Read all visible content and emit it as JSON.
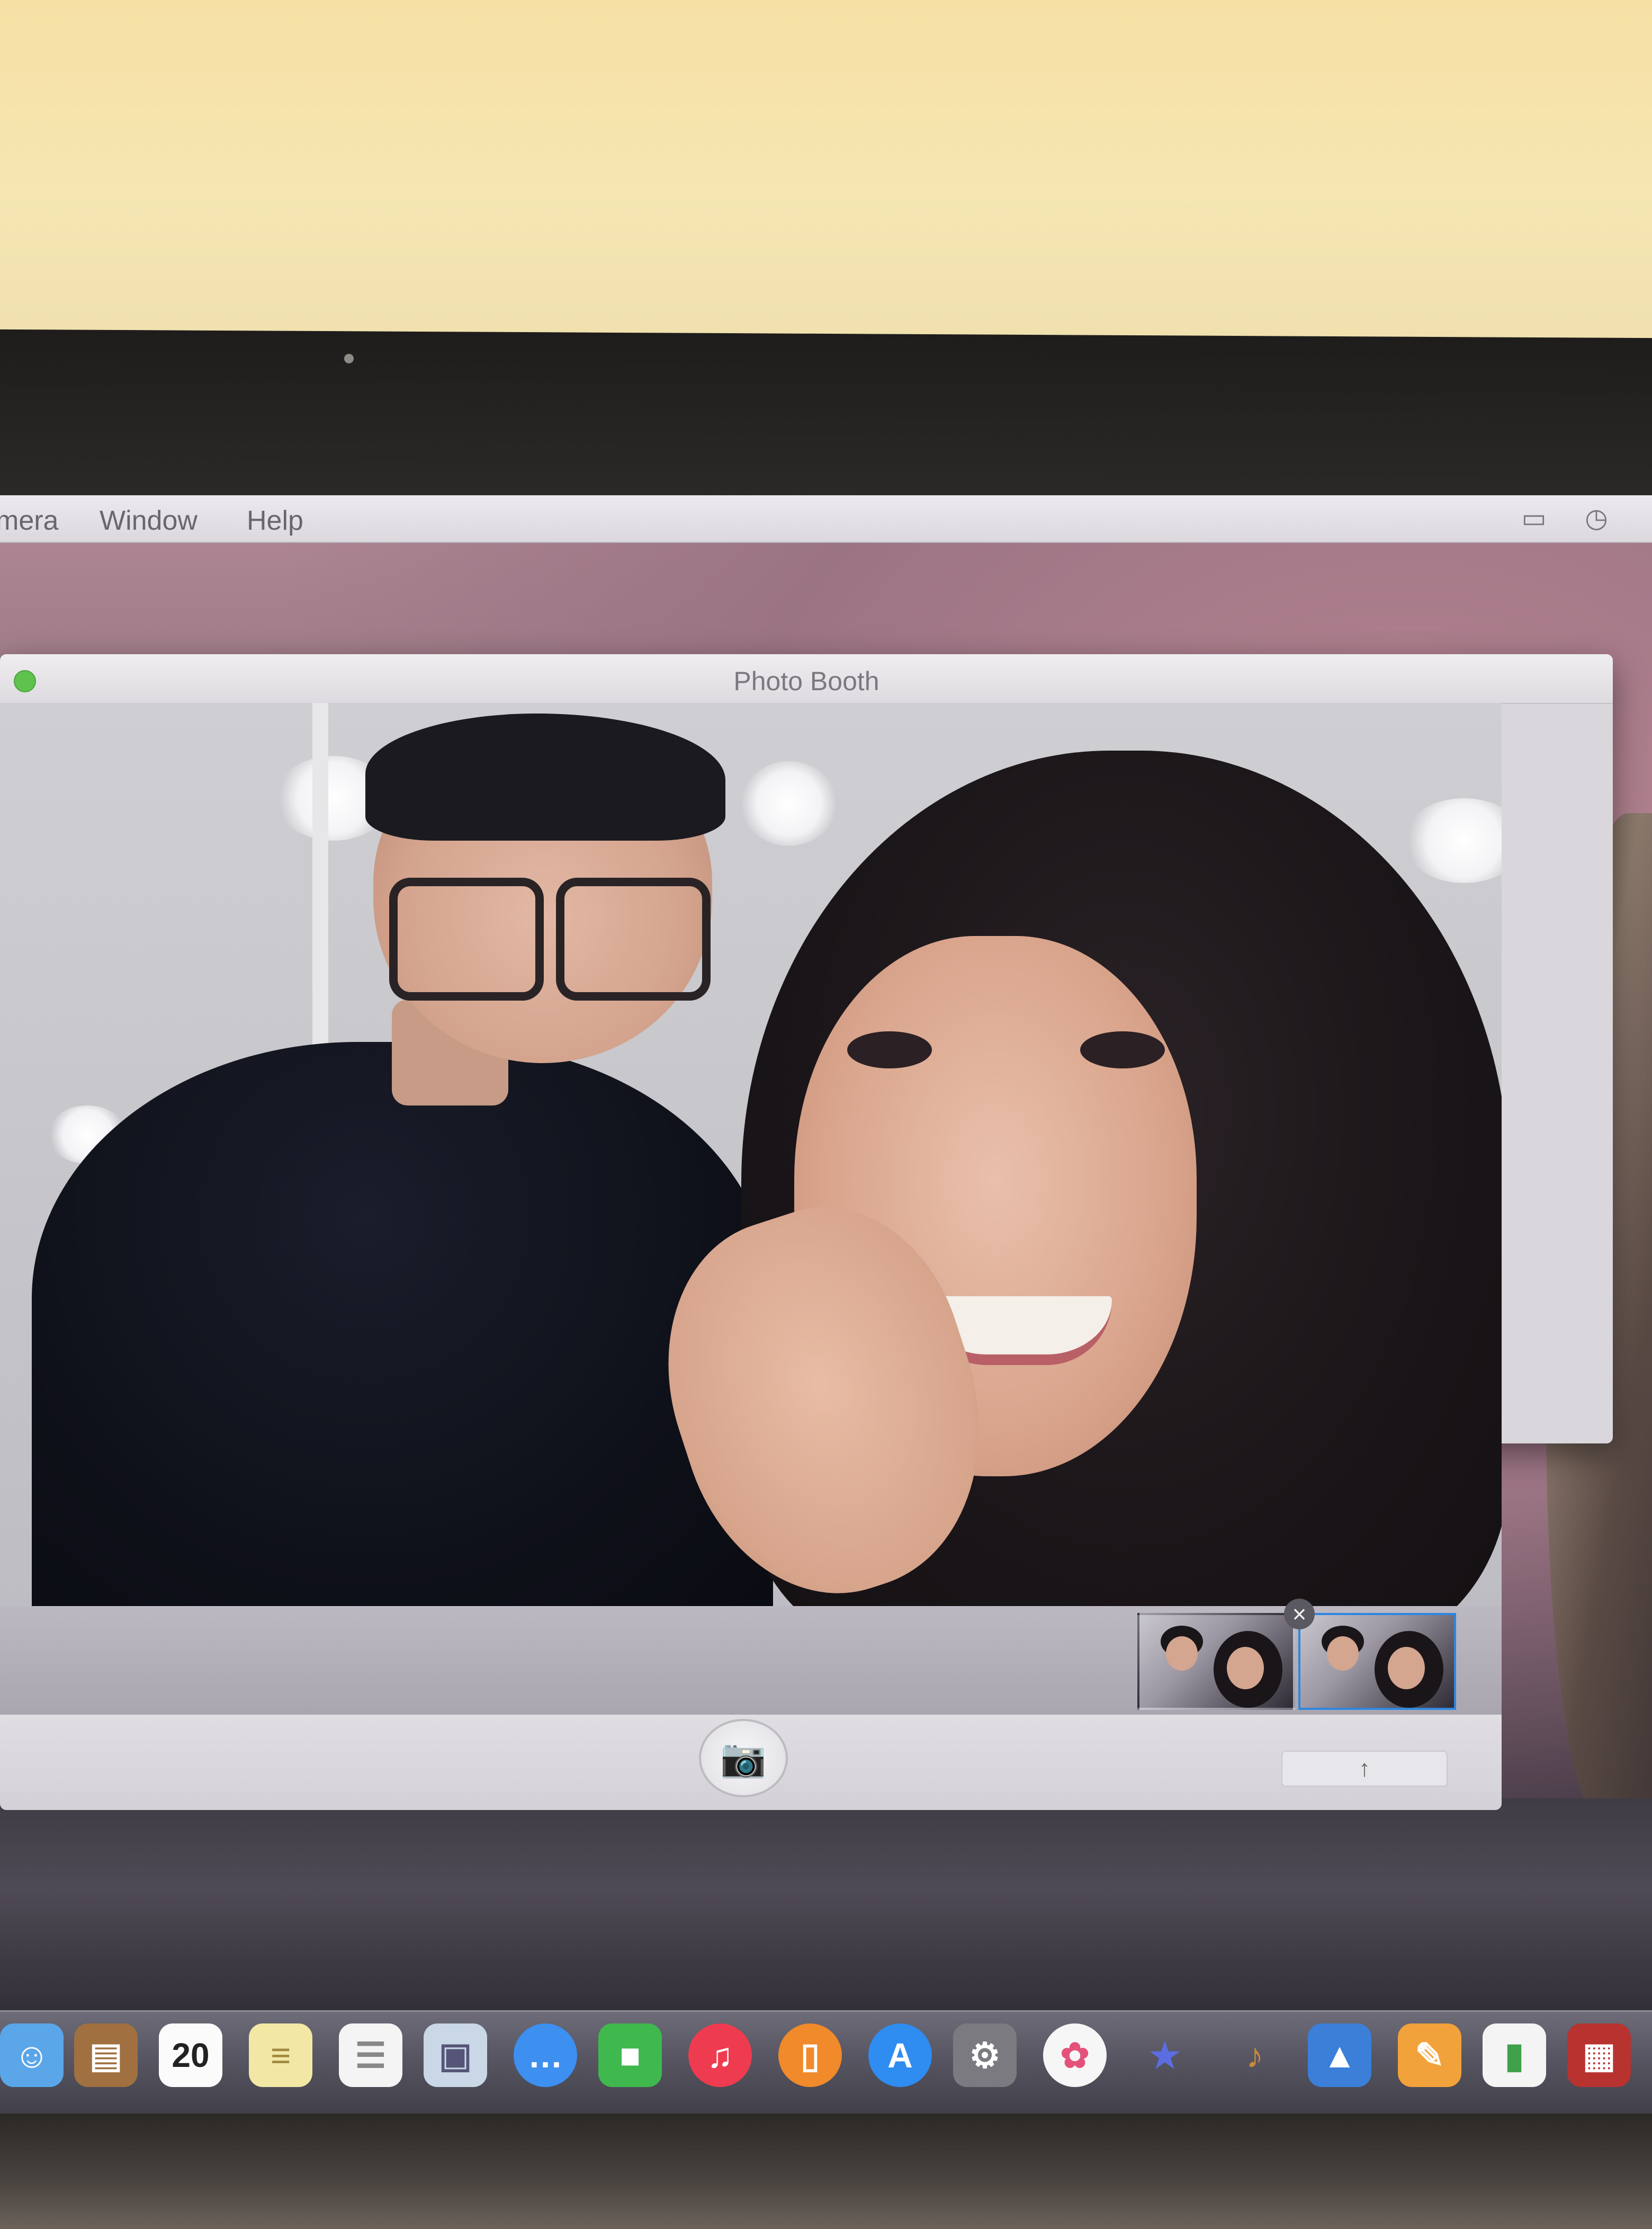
{
  "menubar": {
    "items": [
      "mera",
      "Window",
      "Help"
    ]
  },
  "window": {
    "title": "Photo Booth"
  },
  "thumbnails": [
    {
      "selected": false
    },
    {
      "selected": true
    }
  ],
  "controls": {
    "shutter_glyph": "📷",
    "share_glyph": "↑"
  },
  "dock": {
    "calendar_date": "20",
    "icons": [
      "finder-icon",
      "contacts-icon",
      "calendar-icon",
      "notes-icon",
      "reminders-icon",
      "preview-icon",
      "messages-icon",
      "facetime-icon",
      "itunes-icon",
      "ibooks-icon",
      "app-store-icon",
      "system-preferences-icon",
      "photos-icon",
      "imovie-icon",
      "garageband-icon",
      "keynote-icon",
      "pages-icon",
      "numbers-icon",
      "photo-booth-icon"
    ]
  },
  "colors": {
    "traffic_green": "#5fc24f",
    "selection_blue": "#2f86e0"
  }
}
